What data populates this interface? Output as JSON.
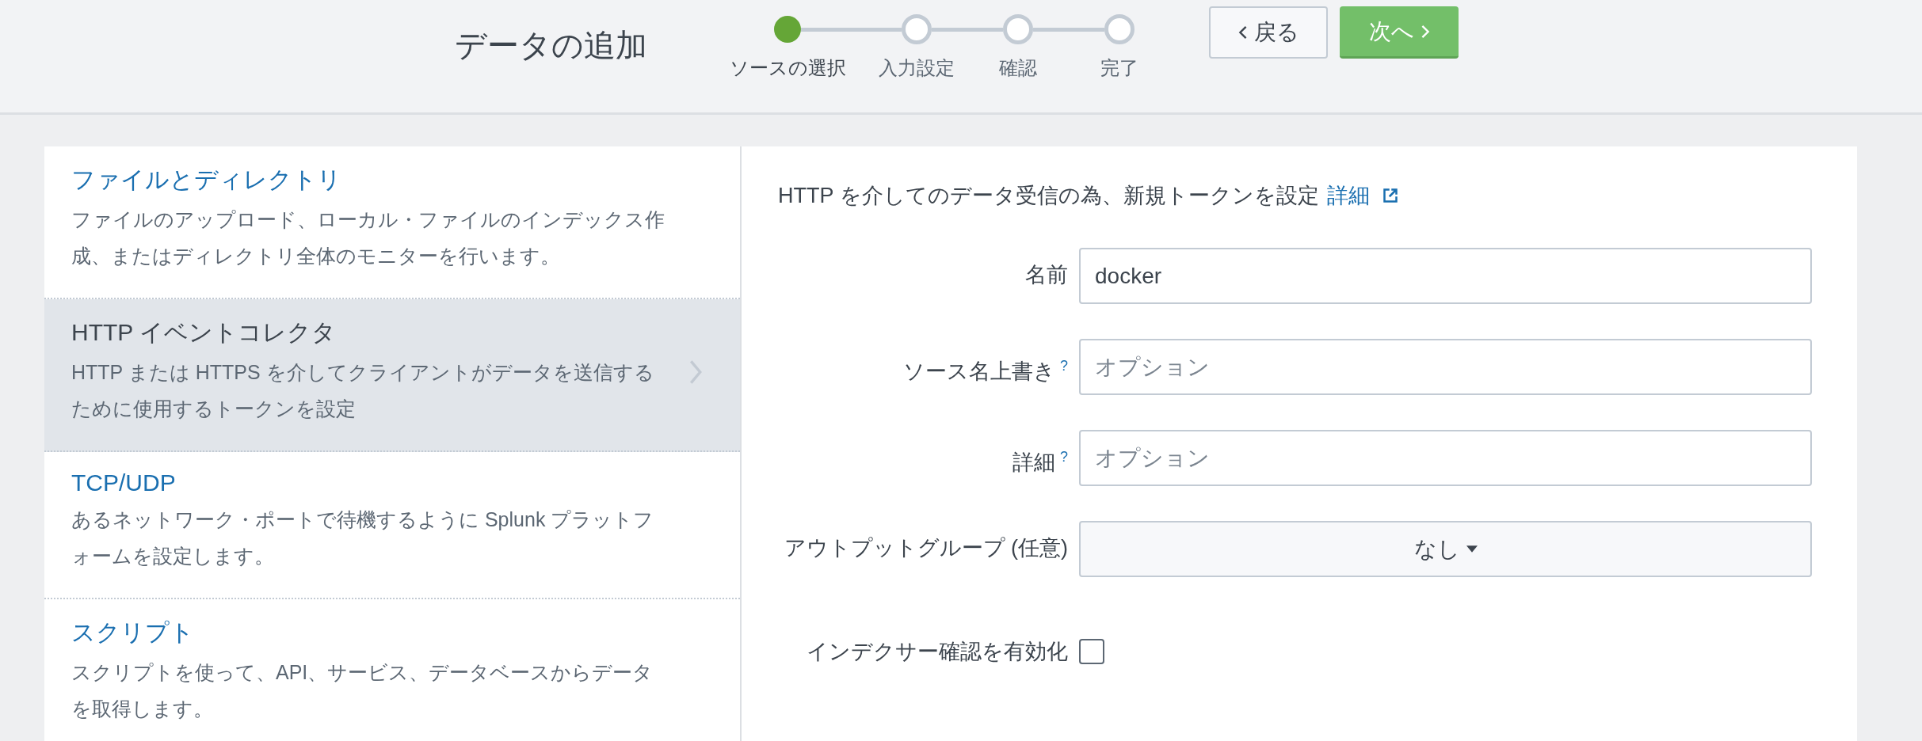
{
  "page_title": "データの追加",
  "steps": [
    {
      "label": "ソースの選択",
      "selected": true
    },
    {
      "label": "入力設定",
      "selected": false
    },
    {
      "label": "確認",
      "selected": false
    },
    {
      "label": "完了",
      "selected": false
    }
  ],
  "buttons": [
    {
      "label": "戻る",
      "kind": "back"
    },
    {
      "label": "次へ",
      "kind": "next"
    }
  ],
  "sources": [
    {
      "title": "ファイルとディレクトリ",
      "description": "ファイルのアップロード、ローカル・ファイルのインデックス作成、またはディレクトリ全体のモニターを行います。",
      "selected": false
    },
    {
      "title": "HTTP イベントコレクタ",
      "description": "HTTP または HTTPS を介してクライアントがデータを送信するために使用するトークンを設定",
      "selected": true
    },
    {
      "title": "TCP/UDP",
      "description": "あるネットワーク・ポートで待機するように Splunk プラットフォームを設定します。",
      "selected": false
    },
    {
      "title": "スクリプト",
      "description": "スクリプトを使って、API、サービス、データベースからデータを取得します。",
      "selected": false
    }
  ],
  "form": {
    "intro": "HTTP を介してのデータ受信の為、新規トークンを設定",
    "intro_link": "詳細",
    "fields": [
      {
        "kind": "text",
        "label": "名前",
        "value": "docker"
      },
      {
        "kind": "text",
        "label": "ソース名上書き",
        "help": "?",
        "placeholder": "オプション"
      },
      {
        "kind": "text",
        "label": "詳細",
        "help": "?",
        "placeholder": "オプション"
      },
      {
        "kind": "select",
        "label": "アウトプットグループ (任意)",
        "value": "なし"
      },
      {
        "kind": "checkbox",
        "label": "インデクサー確認を有効化",
        "checked": false
      }
    ]
  }
}
